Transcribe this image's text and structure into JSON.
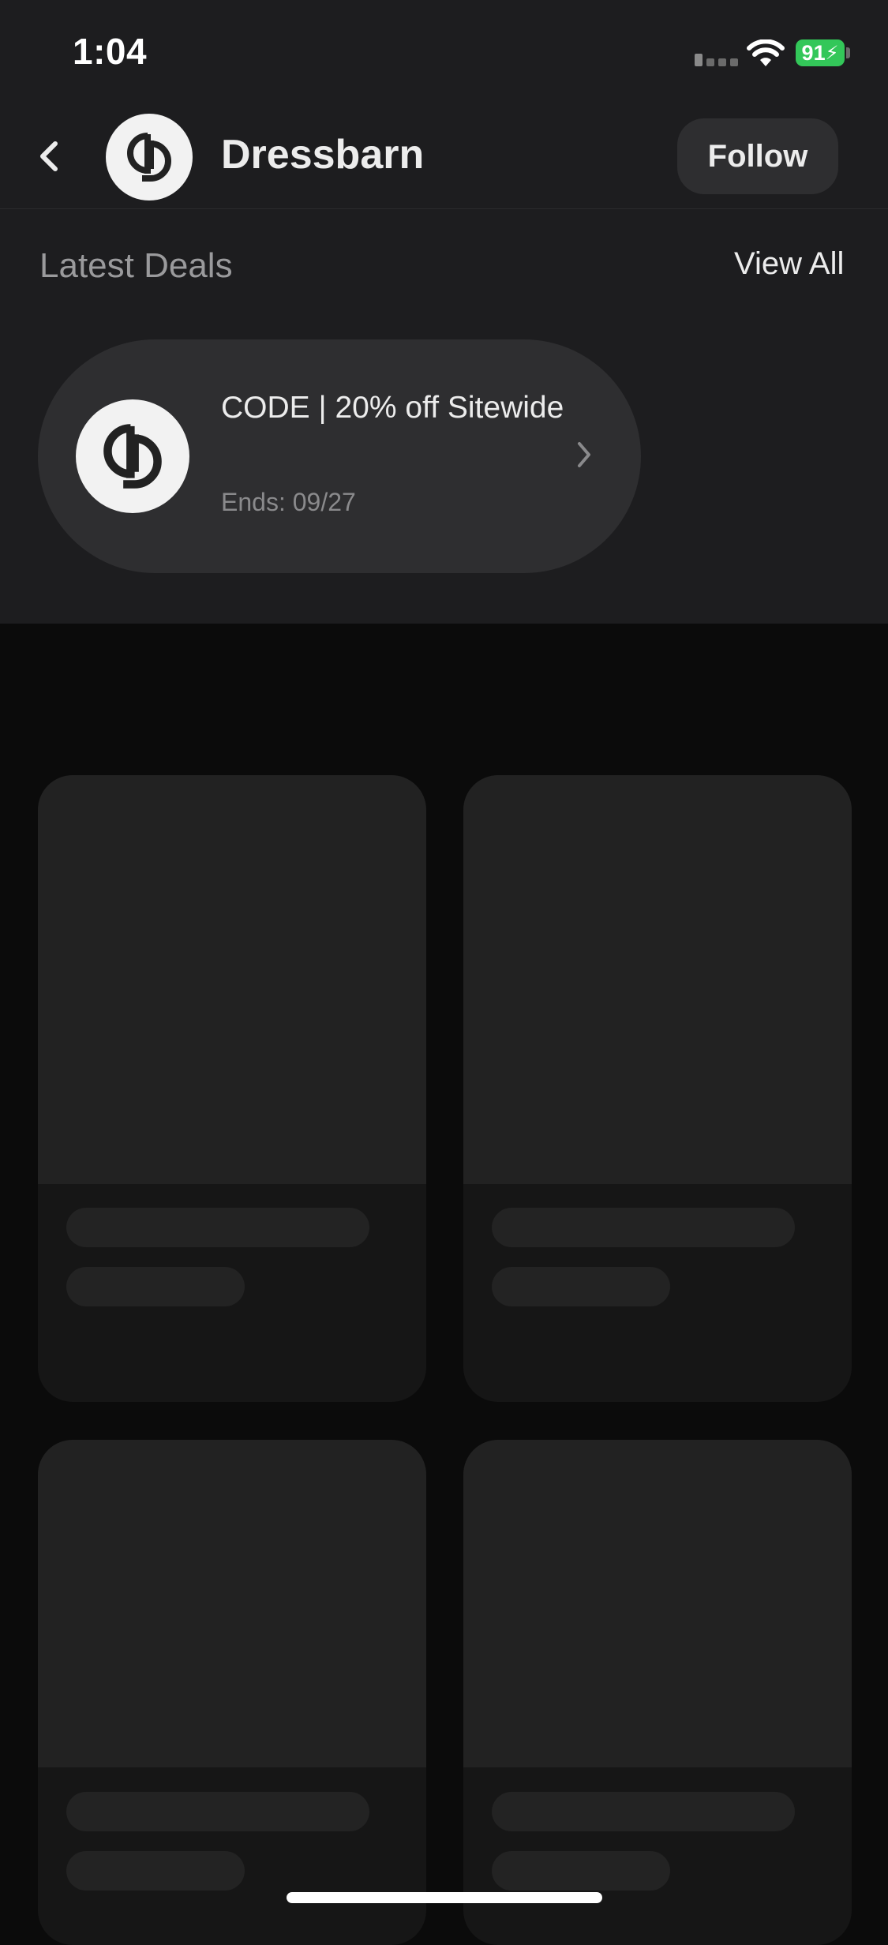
{
  "status_bar": {
    "time": "1:04",
    "battery": "91"
  },
  "header": {
    "brand_name": "Dressbarn",
    "follow_label": "Follow"
  },
  "deals": {
    "section_title": "Latest Deals",
    "view_all_label": "View All",
    "items": [
      {
        "title": "CODE | 20% off Sitewide",
        "ends": "Ends: 09/27"
      }
    ]
  },
  "products": {
    "placeholder_count": 4
  },
  "colors": {
    "background": "#0b0b0b",
    "top_panel": "#1d1d1f",
    "card": "#2e2e30",
    "battery_green": "#33c759"
  }
}
